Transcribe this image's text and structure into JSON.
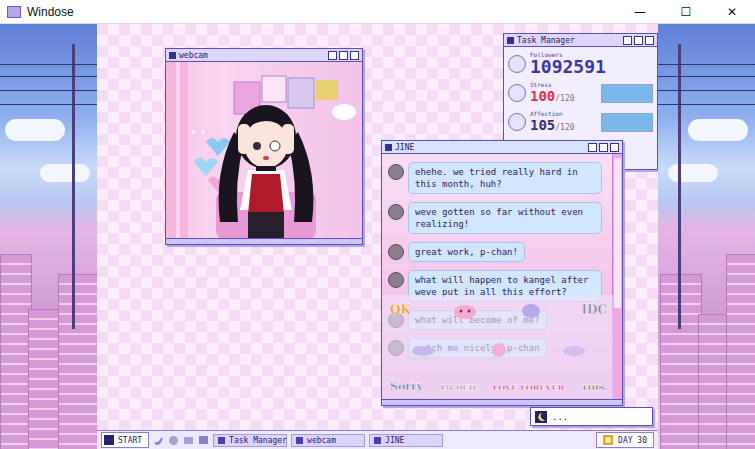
{
  "window": {
    "title": "Windose",
    "controls": [
      "—",
      "☐",
      "✕"
    ]
  },
  "webcam": {
    "title": "webcam"
  },
  "task_manager": {
    "title": "Task Manager",
    "stats": [
      {
        "label": "Followers",
        "value": "1092591",
        "color": "#3b35a8"
      },
      {
        "label": "Stress",
        "value": "100",
        "max": "/120",
        "level": 1,
        "color": "#d9344f"
      },
      {
        "label": "Affection",
        "value": "105",
        "max": "/120",
        "level": 1,
        "color": "#35307a"
      }
    ]
  },
  "jine": {
    "title": "JINE",
    "messages": [
      "ehehe. we tried really hard in this month, huh?",
      "weve gotten so far without even realizing!",
      "great work, p-chan!",
      "what will happen to kangel after weve put in all this effort?",
      "what will become of me?",
      "watch me nicely, p-chan"
    ],
    "stamps": [
      {
        "text": "OK",
        "color": "#e8a020"
      },
      {
        "text": "IDC",
        "color": "#8a8aa0"
      },
      {
        "text": "Sorry",
        "color": "#7a7aa8"
      },
      {
        "text": "IM DED",
        "color": "#9a9a9a"
      },
      {
        "text": "LOVE FOREVER",
        "color": "#e0407a"
      },
      {
        "text": "THIS.",
        "color": "#707070"
      }
    ]
  },
  "input": {
    "text": "..."
  },
  "taskbar": {
    "start": "START",
    "items": [
      {
        "label": "Task Manager"
      },
      {
        "label": "webcam"
      },
      {
        "label": "JINE"
      }
    ],
    "day": "DAY 30"
  }
}
